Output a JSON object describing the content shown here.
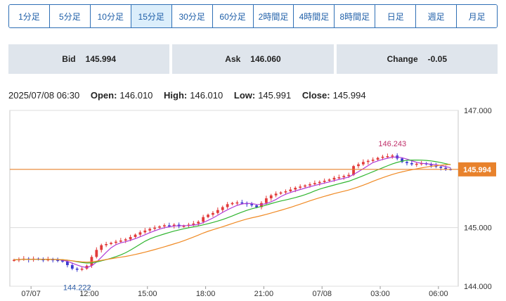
{
  "timeframe_tabs": [
    {
      "label": "1分足",
      "active": false
    },
    {
      "label": "5分足",
      "active": false
    },
    {
      "label": "10分足",
      "active": false
    },
    {
      "label": "15分足",
      "active": true
    },
    {
      "label": "30分足",
      "active": false
    },
    {
      "label": "60分足",
      "active": false
    },
    {
      "label": "2時間足",
      "active": false
    },
    {
      "label": "4時間足",
      "active": false
    },
    {
      "label": "8時間足",
      "active": false
    },
    {
      "label": "日足",
      "active": false
    },
    {
      "label": "週足",
      "active": false
    },
    {
      "label": "月足",
      "active": false
    }
  ],
  "quotes": {
    "bid_label": "Bid",
    "bid_value": "145.994",
    "ask_label": "Ask",
    "ask_value": "146.060",
    "change_label": "Change",
    "change_value": "-0.05"
  },
  "ohlc": {
    "datetime": "2025/07/08 06:30",
    "open_label": "Open:",
    "open_value": "146.010",
    "high_label": "High:",
    "high_value": "146.010",
    "low_label": "Low:",
    "low_value": "145.991",
    "close_label": "Close:",
    "close_value": "145.994"
  },
  "colors": {
    "up": "#e23b3b",
    "down": "#3a3ad0",
    "ma_short": "#b03bd6",
    "ma_mid": "#2fb52f",
    "ma_long": "#f08a24",
    "price_line": "#e8822c",
    "accent": "#1f5fa8"
  },
  "chart_data": {
    "type": "candlestick",
    "y_ticks": [
      "147.000",
      "145.000",
      "144.000"
    ],
    "ylim": [
      144.0,
      147.0
    ],
    "x_tick_labels": [
      "07/07",
      "12:00",
      "15:00",
      "18:00",
      "21:00",
      "07/08",
      "03:00",
      "06:00"
    ],
    "x_tick_positions": [
      3.5,
      15.5,
      27.5,
      39.5,
      51.5,
      63.5,
      75.5,
      87.5
    ],
    "current_price": 145.994,
    "current_price_label": "145.994",
    "high_annotation": {
      "label": "146.243",
      "value": 146.243,
      "index": 78
    },
    "low_annotation": {
      "label": "144.222",
      "value": 144.222,
      "index": 13
    },
    "close": [
      144.45,
      144.46,
      144.47,
      144.45,
      144.47,
      144.46,
      144.45,
      144.46,
      144.45,
      144.44,
      144.42,
      144.36,
      144.3,
      144.29,
      144.3,
      144.35,
      144.5,
      144.62,
      144.7,
      144.72,
      144.74,
      144.76,
      144.78,
      144.8,
      144.84,
      144.88,
      144.92,
      144.95,
      144.98,
      145.0,
      145.02,
      145.04,
      145.03,
      145.05,
      145.02,
      145.03,
      145.05,
      145.07,
      145.1,
      145.18,
      145.22,
      145.25,
      145.3,
      145.35,
      145.4,
      145.42,
      145.43,
      145.42,
      145.4,
      145.38,
      145.35,
      145.42,
      145.5,
      145.55,
      145.58,
      145.6,
      145.62,
      145.65,
      145.68,
      145.7,
      145.72,
      145.74,
      145.76,
      145.78,
      145.8,
      145.82,
      145.85,
      145.86,
      145.88,
      145.9,
      146.05,
      146.08,
      146.12,
      146.14,
      146.16,
      146.19,
      146.21,
      146.22,
      146.23,
      146.18,
      146.12,
      146.1,
      146.08,
      146.09,
      146.1,
      146.08,
      146.06,
      146.04,
      146.02,
      146.0,
      145.994
    ]
  }
}
